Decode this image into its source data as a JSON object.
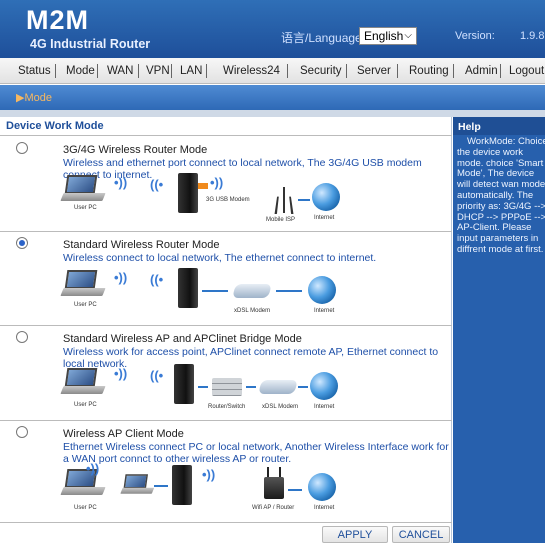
{
  "header": {
    "brand": "M2M",
    "subbrand": "4G Industrial Router",
    "language_label": "语言/Language:",
    "language_selected": "English",
    "version_label": "Version:",
    "version_value": "1.9.8"
  },
  "nav": {
    "items": [
      "Status",
      "Mode",
      "WAN",
      "VPN",
      "LAN",
      "Wireless24",
      "Security",
      "Server",
      "Routing",
      "Admin",
      "Logout"
    ]
  },
  "breadcrumb": "▶Mode",
  "main": {
    "section_title": "Device Work Mode",
    "options": [
      {
        "title": "3G/4G Wireless Router Mode",
        "description": "Wireless and ethernet port connect to local network, The 3G/4G USB modem connect to internet.",
        "selected": false,
        "captions": [
          "User PC",
          "3G USB Modem",
          "Mobile ISP",
          "Internet"
        ]
      },
      {
        "title": "Standard Wireless Router Mode",
        "description": "Wireless connect to local network, The ethernet connect to internet.",
        "selected": true,
        "captions": [
          "User PC",
          "xDSL Modem",
          "Internet"
        ]
      },
      {
        "title": "Standard Wireless AP and APClinet Bridge Mode",
        "description": "Wireless work for access point, APClinet connect remote AP, Ethernet connect to local network.",
        "selected": false,
        "captions": [
          "User PC",
          "Router/Switch",
          "xDSL Modem",
          "Internet"
        ]
      },
      {
        "title": "Wireless AP Client Mode",
        "description": "Ethernet Wireless connect PC or local network, Another Wireless Interface work for a WAN port connct to other wireless AP or router.",
        "selected": false,
        "captions": [
          "User PC",
          "Wifi AP / Router",
          "Internet"
        ]
      }
    ],
    "apply_label": "APPLY",
    "cancel_label": "CANCEL"
  },
  "help": {
    "title": "Help",
    "body": "WorkMode: Choice the device work mode. choice 'Smart Mode', The device will detect wan mode automatically. The priority as: 3G/4G --> DHCP --> PPPoE --> AP-Client. Please input parameters in diffrent mode at first."
  },
  "colors": {
    "header_blue": "#1e4f9a",
    "accent_blue": "#2e69b6",
    "help_blue": "#2760ad",
    "breadcrumb_orange": "#f8b860",
    "link_blue": "#1e4fa8"
  }
}
